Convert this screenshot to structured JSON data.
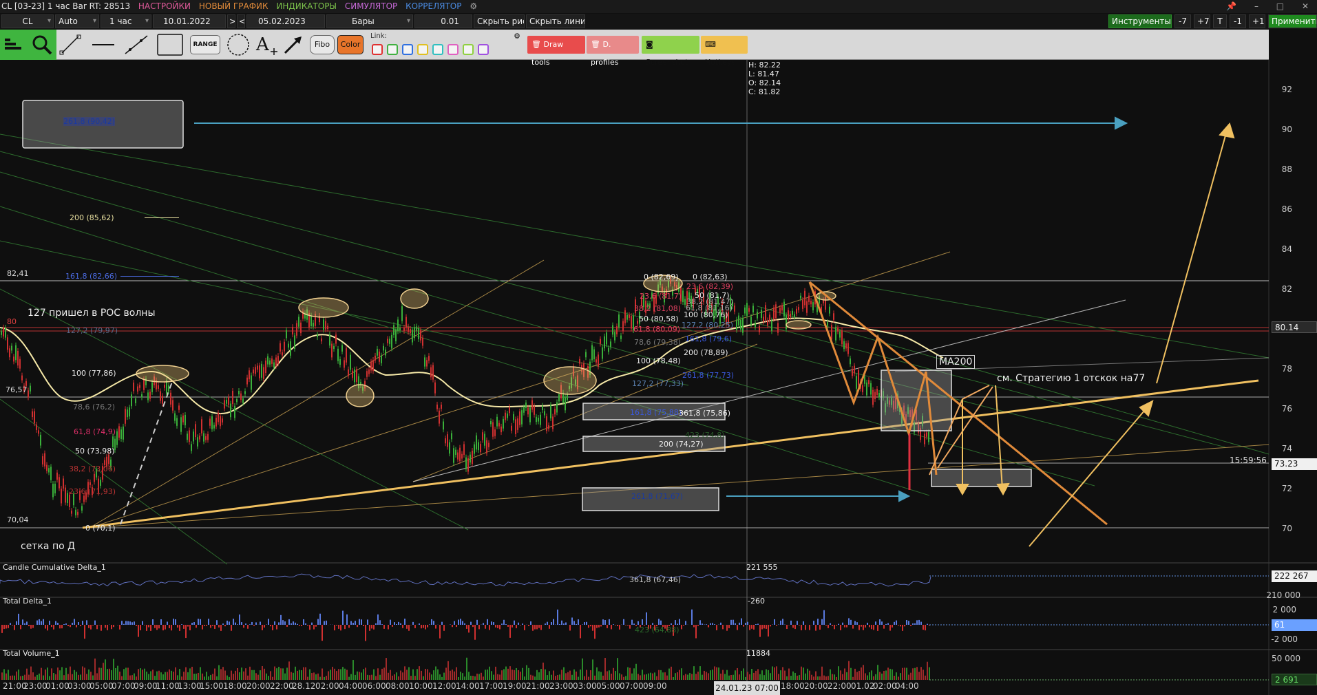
{
  "titlebar": {
    "title": "CL [03-23] 1 час Bar RT: 28513",
    "menu": [
      {
        "label": "НАСТРОЙКИ",
        "color": "#e05a9a"
      },
      {
        "label": "НОВЫЙ ГРАФИК",
        "color": "#e08a3a"
      },
      {
        "label": "ИНДИКАТОРЫ",
        "color": "#7ac04a"
      },
      {
        "label": "СИМУЛЯТОР",
        "color": "#c86ad8"
      },
      {
        "label": "КОРРЕЛЯТОР",
        "color": "#4a8ae0"
      }
    ],
    "win_pin": "📌",
    "win_min": "–",
    "win_max": "□",
    "win_close": "✕"
  },
  "controls": {
    "symbol": "CL",
    "scale": "Auto",
    "timeframe": "1 час",
    "date_from": "10.01.2022",
    "nav_next": ">",
    "nav_prev": "<",
    "date_to": "05.02.2023",
    "chart_type": "Бары",
    "step": "0.01",
    "hide_drawings": "Скрыть рис.",
    "hide_lines": "Скрыть линии",
    "instruments": "Инструменты",
    "btn_m7": "-7",
    "btn_p7": "+7",
    "btn_t": "T",
    "btn_m1": "-1",
    "btn_p1": "+1",
    "apply": "Применить"
  },
  "toolbar": {
    "range_label": "RANGE",
    "fibo_label": "Fibo",
    "color_label": "Color",
    "link_label": "Link:",
    "link_colors": [
      "#e03030",
      "#40b040",
      "#3070e0",
      "#e0c020",
      "#30c0c0",
      "#e060c0",
      "#90d040",
      "#a050e0"
    ],
    "draw_tools": "Draw tools",
    "d_profiles": "D. profiles",
    "screenshot": "Screenshot",
    "hotkeys": "Hotkeys"
  },
  "ohlc": {
    "h": "H: 82.22",
    "l": "L: 81.47",
    "o": "O: 82.14",
    "c": "C: 81.82"
  },
  "price_axis": {
    "ticks": [
      "92",
      "90",
      "88",
      "86",
      "84",
      "82",
      "80",
      "78",
      "76",
      "74",
      "72",
      "70"
    ],
    "current_price": "80.14",
    "last_price": "73.23",
    "timer": "15:59:56"
  },
  "annotations": {
    "fib_top_box": "261,8 (90,42)",
    "level_200": "200 (85,62)",
    "level_161": "161,8 (82,66)",
    "level_8241": "82,41",
    "level_80": "80",
    "poc_note": "127 пришел в POC волны",
    "level_1272": "127,2 (79,97)",
    "level_100": "100 (77,86)",
    "level_7657": "76,57",
    "level_786": "78,6 (76,2)",
    "level_618": "61,8 (74,9)",
    "level_50": "50 (73,98)",
    "level_382": "38,2 (73,06)",
    "level_236": "23,6 (71,93)",
    "level_7004": "70,04",
    "level_0": "0 (70,1)",
    "grid_note": "сетка по Д",
    "mid_0": "0 (82,69)",
    "mid_236": "23,6 (81,7)",
    "mid_382": "38,2 (81,08)",
    "mid_50": "50 (80,58)",
    "mid_618": "61,8 (80,09)",
    "mid_786": "78,6 (79,38)",
    "mid_100": "100 (78,48)",
    "mid_1272": "127,2 (77,33)",
    "mid_1618": "161,8 (75,88)",
    "mid_3618": "361,8 (75,86)",
    "mid_200": "200 (74,27)",
    "mid_2618": "261,8 (71,67)",
    "mid_423": "423 (74,8)",
    "r_0": "0 (82,63)",
    "r_236": "23,6 (82,39)",
    "r_382": "38,2 (81,47)",
    "r_50": "50 (81,7)",
    "r_618": "61,8 (81,16)",
    "r_100": "100 (80,76)",
    "r_1272": "127,2 (80,25)",
    "r_1618": "161,8 (79,6)",
    "r_200": "200 (78,89)",
    "r_2618": "261,8 (77,73)",
    "ma200": "MA200",
    "strategy_note": "см. Стратегию 1 отскок на77"
  },
  "subcharts": {
    "ccd_title": "Candle Cumulative Delta_1",
    "ccd_value": "221 555",
    "ccd_fib": "361,8 (67,46)",
    "ccd_axis_hi": "222 267",
    "ccd_axis_lo": "210 000",
    "td_title": "Total Delta_1",
    "td_value": "-260",
    "td_fib": "423 (64,88)",
    "td_axis_hi": "2 000",
    "td_axis_cur": "61",
    "td_axis_lo": "-2 000",
    "tv_title": "Total Volume_1",
    "tv_value": "11884",
    "tv_axis_hi": "50 000",
    "tv_axis_cur": "2 691"
  },
  "time_axis": {
    "labels": [
      "21:00",
      "23:00",
      "01:00",
      "03:00",
      "05:00",
      "07:00",
      "09:00",
      "11:00",
      "13:00",
      "15:00",
      "18:00",
      "20:00",
      "22:00",
      "28.12",
      "02:00",
      "04:00",
      "06:00",
      "08:00",
      "10:00",
      "12:00",
      "14:00",
      "17:00",
      "19:00",
      "21:00",
      "23:00",
      "03:00",
      "05:00",
      "07:00",
      "09:00",
      "18:00",
      "20:00",
      "22:00",
      "01.02",
      "02:00",
      "04:00"
    ],
    "cursor_date": "24.01.23 07:00"
  }
}
